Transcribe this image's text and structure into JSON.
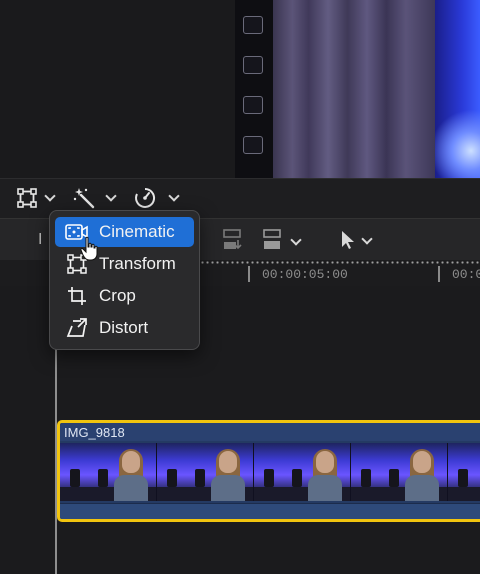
{
  "menu": {
    "items": [
      {
        "label": "Cinematic",
        "icon": "cinematic-icon",
        "selected": true
      },
      {
        "label": "Transform",
        "icon": "transform-icon",
        "selected": false
      },
      {
        "label": "Crop",
        "icon": "crop-icon",
        "selected": false
      },
      {
        "label": "Distort",
        "icon": "distort-icon",
        "selected": false
      }
    ]
  },
  "ruler": {
    "timecodes": [
      "00:00:05:00",
      "00:0"
    ]
  },
  "clip": {
    "name": "IMG_9818"
  },
  "toolbar": {
    "left_clip": "I"
  },
  "colors": {
    "accent": "#1f6fd6",
    "clip_border": "#f1c40f",
    "clip_fill": "#243a63"
  }
}
